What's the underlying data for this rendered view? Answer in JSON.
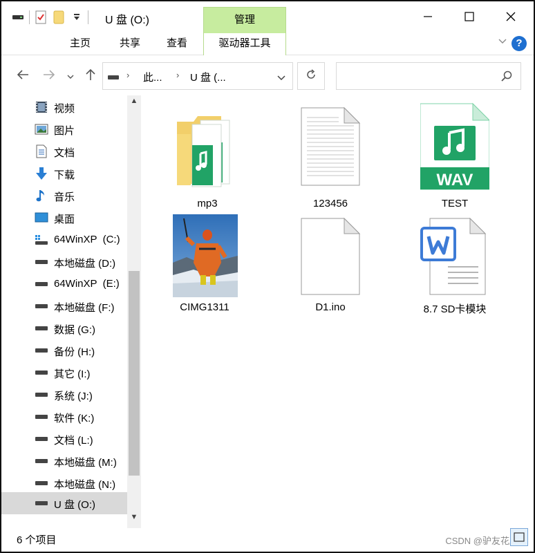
{
  "window": {
    "title": "U 盘 (O:)",
    "context_tab": "管理",
    "minimize_icon": "minimize-icon",
    "maximize_icon": "maximize-icon",
    "close_icon": "close-icon"
  },
  "quick_access": [
    "drive-icon",
    "properties-icon",
    "folder-icon",
    "customize-dropdown-icon"
  ],
  "ribbon": {
    "tabs": [
      {
        "label": "主页",
        "active": false
      },
      {
        "label": "共享",
        "active": false
      },
      {
        "label": "查看",
        "active": false
      },
      {
        "label": "驱动器工具",
        "active": true
      }
    ],
    "help_label": "?"
  },
  "address": {
    "segments": [
      "此...",
      "U 盘 (..."
    ],
    "search_placeholder": ""
  },
  "nav_pane": {
    "items": [
      {
        "label": "视频",
        "icon": "video-icon",
        "selected": false
      },
      {
        "label": "图片",
        "icon": "pictures-icon",
        "selected": false
      },
      {
        "label": "文档",
        "icon": "documents-icon",
        "selected": false
      },
      {
        "label": "下载",
        "icon": "download-icon",
        "selected": false
      },
      {
        "label": "音乐",
        "icon": "music-icon",
        "selected": false
      },
      {
        "label": "桌面",
        "icon": "desktop-icon",
        "selected": false
      },
      {
        "label": "64WinXP  (C:)",
        "icon": "system-drive-icon",
        "selected": false
      },
      {
        "label": "本地磁盘 (D:)",
        "icon": "drive-icon",
        "selected": false
      },
      {
        "label": "64WinXP  (E:)",
        "icon": "drive-icon",
        "selected": false
      },
      {
        "label": "本地磁盘 (F:)",
        "icon": "drive-icon",
        "selected": false
      },
      {
        "label": "数据 (G:)",
        "icon": "drive-icon",
        "selected": false
      },
      {
        "label": "备份 (H:)",
        "icon": "drive-icon",
        "selected": false
      },
      {
        "label": "其它 (I:)",
        "icon": "drive-icon",
        "selected": false
      },
      {
        "label": "系统 (J:)",
        "icon": "drive-icon",
        "selected": false
      },
      {
        "label": "软件 (K:)",
        "icon": "drive-icon",
        "selected": false
      },
      {
        "label": "文档 (L:)",
        "icon": "drive-icon",
        "selected": false
      },
      {
        "label": "本地磁盘 (M:)",
        "icon": "drive-icon",
        "selected": false
      },
      {
        "label": "本地磁盘 (N:)",
        "icon": "drive-icon",
        "selected": false
      },
      {
        "label": "U 盘 (O:)",
        "icon": "drive-icon",
        "selected": true
      }
    ]
  },
  "files": [
    {
      "name": "mp3",
      "icon": "folder-music-icon"
    },
    {
      "name": "123456",
      "icon": "text-file-icon"
    },
    {
      "name": "TEST",
      "icon": "wav-file-icon",
      "badge": "WAV"
    },
    {
      "name": "CIMG1311",
      "icon": "photo-thumbnail-icon"
    },
    {
      "name": "D1.ino",
      "icon": "blank-file-icon"
    },
    {
      "name": "8.7 SD卡模块",
      "icon": "word-document-icon"
    }
  ],
  "status": {
    "item_count": "6 个项目",
    "watermark": "CSDN @驴友花雕"
  },
  "colors": {
    "context_tab": "#c7ec9f",
    "selection": "#d9d9d9",
    "wav_green": "#21a366",
    "word_blue": "#3d7bd6",
    "folder_yellow": "#f6d97a"
  }
}
